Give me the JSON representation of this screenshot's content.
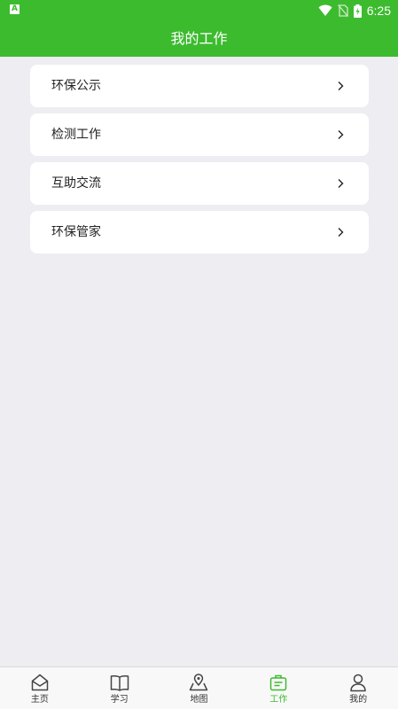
{
  "status_bar": {
    "notification_letter": "A",
    "time": "6:25"
  },
  "header": {
    "title": "我的工作"
  },
  "menu": {
    "items": [
      {
        "label": "环保公示"
      },
      {
        "label": "检测工作"
      },
      {
        "label": "互助交流"
      },
      {
        "label": "环保管家"
      }
    ]
  },
  "tabbar": {
    "items": [
      {
        "label": "主页",
        "icon": "home-icon"
      },
      {
        "label": "学习",
        "icon": "book-icon"
      },
      {
        "label": "地图",
        "icon": "map-icon"
      },
      {
        "label": "工作",
        "icon": "briefcase-icon",
        "active": true
      },
      {
        "label": "我的",
        "icon": "user-icon"
      }
    ]
  },
  "colors": {
    "accent": "#3dbb2f",
    "background": "#eeedf1"
  }
}
